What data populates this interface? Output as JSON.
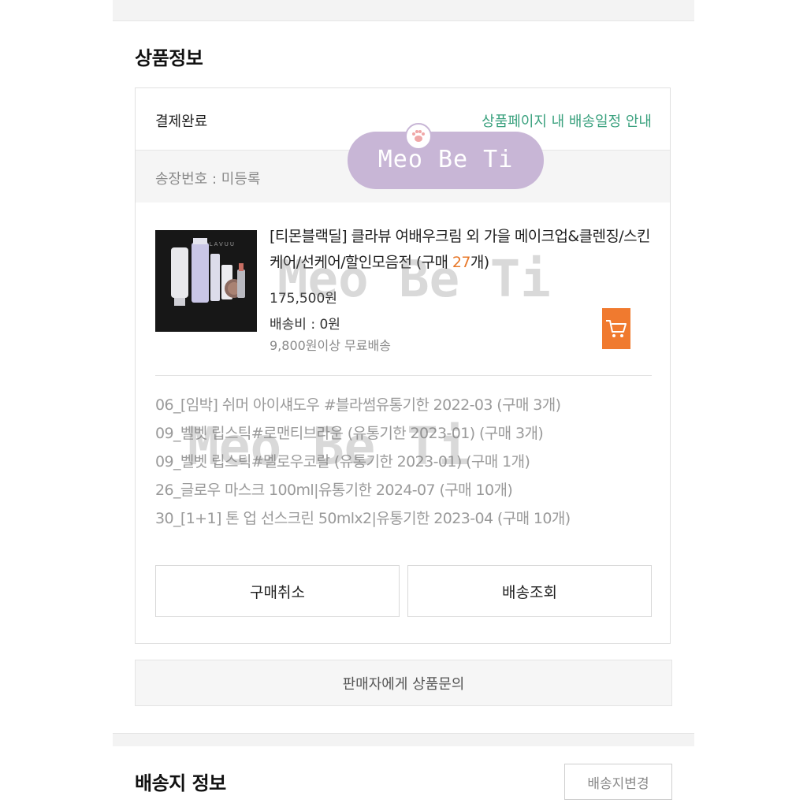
{
  "section": {
    "product_info_title": "상품정보",
    "shipping_info_title": "배송지 정보"
  },
  "order": {
    "status": "결제완료",
    "schedule_link": "상품페이지 내 배송일정 안내",
    "tracking": "송장번호 : 미등록"
  },
  "product": {
    "thumb_brand": "KLAVUU",
    "title_main": "[티몬블랙딜] 클라뷰 여배우크림 외 가을 메이크업&클렌징/스킨케어/선케어/할인모음전 (구매 ",
    "title_qty": "27",
    "title_end": "개)",
    "price": "175,500원",
    "shipping_fee": "배송비 : 0원",
    "free_shipping": "9,800원이상 무료배송"
  },
  "options": [
    "06_[임박] 쉬머 아이섀도우 #블라썸유통기한 2022-03 (구매 3개)",
    "09_벨벳 립스틱#로맨티브라운 (유통기한 2023-01) (구매 3개)",
    "09_벨벳 립스틱#멜로우코랄 (유통기한 2023-01) (구매 1개)",
    "26_글로우 마스크 100ml|유통기한 2024-07 (구매 10개)",
    "30_[1+1] 톤 업 선스크린 50mlx2|유통기한 2023-04 (구매 10개)"
  ],
  "buttons": {
    "cancel": "구매취소",
    "track": "배송조회",
    "inquiry": "판매자에게 상품문의",
    "change_address": "배송지변경"
  },
  "watermark": {
    "badge": "Meo Be Ti",
    "overlay1": "Meo Be Ti",
    "overlay2": "Meo Be Ti"
  },
  "colors": {
    "accent_green": "#3aa17e",
    "accent_orange": "#f07a2f",
    "watermark_purple": "#c8b6d6"
  },
  "icons": {
    "cart": "shopping-cart-icon",
    "paw": "cat-paw-icon"
  }
}
